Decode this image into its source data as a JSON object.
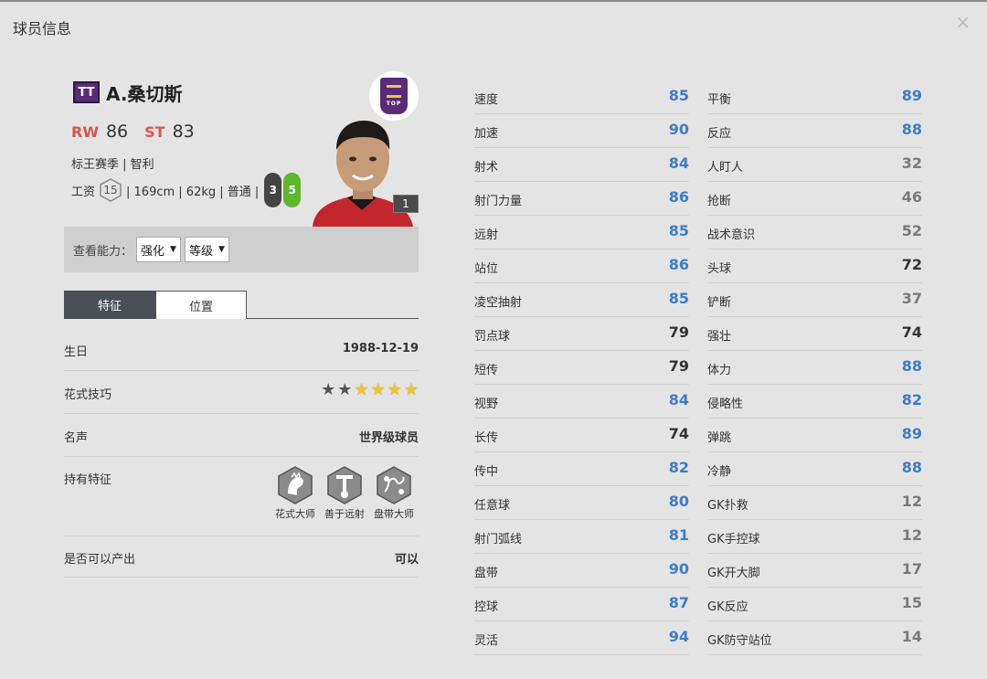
{
  "dialog": {
    "title": "球员信息",
    "close": "×"
  },
  "player": {
    "card_type": "TT",
    "name": "A.桑切斯",
    "positions": [
      {
        "pos": "RW",
        "rating": "86"
      },
      {
        "pos": "ST",
        "rating": "83"
      }
    ],
    "season_line": "标王赛季 | 智利",
    "salary_label": "工资",
    "salary": "15",
    "body_line": "| 169cm | 62kg | 普通 |",
    "weak_foot": "3",
    "strong_foot": "5",
    "club_badge_text": "TOP",
    "level": "1"
  },
  "ability": {
    "label": "查看能力：",
    "select1": "强化",
    "select2": "等级"
  },
  "tabs": [
    "特征",
    "位置"
  ],
  "details": {
    "birthday_label": "生日",
    "birthday": "1988-12-19",
    "skill_label": "花式技巧",
    "skill_stars": 5,
    "skill_dark_stars": 2,
    "reputation_label": "名声",
    "reputation": "世界级球员",
    "traits_label": "持有特征",
    "traits": [
      "花式大师",
      "善于远射",
      "盘带大师"
    ],
    "producible_label": "是否可以产出",
    "producible": "可以"
  },
  "stats_left": [
    {
      "name": "速度",
      "value": "85",
      "tone": "blue"
    },
    {
      "name": "加速",
      "value": "90",
      "tone": "blue"
    },
    {
      "name": "射术",
      "value": "84",
      "tone": "blue"
    },
    {
      "name": "射门力量",
      "value": "86",
      "tone": "blue"
    },
    {
      "name": "远射",
      "value": "85",
      "tone": "blue"
    },
    {
      "name": "站位",
      "value": "86",
      "tone": "blue"
    },
    {
      "name": "凌空抽射",
      "value": "85",
      "tone": "blue"
    },
    {
      "name": "罚点球",
      "value": "79",
      "tone": "black"
    },
    {
      "name": "短传",
      "value": "79",
      "tone": "black"
    },
    {
      "name": "视野",
      "value": "84",
      "tone": "blue"
    },
    {
      "name": "长传",
      "value": "74",
      "tone": "black"
    },
    {
      "name": "传中",
      "value": "82",
      "tone": "blue"
    },
    {
      "name": "任意球",
      "value": "80",
      "tone": "blue"
    },
    {
      "name": "射门弧线",
      "value": "81",
      "tone": "blue"
    },
    {
      "name": "盘带",
      "value": "90",
      "tone": "blue"
    },
    {
      "name": "控球",
      "value": "87",
      "tone": "blue"
    },
    {
      "name": "灵活",
      "value": "94",
      "tone": "blue"
    }
  ],
  "stats_right": [
    {
      "name": "平衡",
      "value": "89",
      "tone": "blue"
    },
    {
      "name": "反应",
      "value": "88",
      "tone": "blue"
    },
    {
      "name": "人盯人",
      "value": "32",
      "tone": "gray"
    },
    {
      "name": "抢断",
      "value": "46",
      "tone": "gray"
    },
    {
      "name": "战术意识",
      "value": "52",
      "tone": "gray"
    },
    {
      "name": "头球",
      "value": "72",
      "tone": "black"
    },
    {
      "name": "铲断",
      "value": "37",
      "tone": "gray"
    },
    {
      "name": "强壮",
      "value": "74",
      "tone": "black"
    },
    {
      "name": "体力",
      "value": "88",
      "tone": "blue"
    },
    {
      "name": "侵略性",
      "value": "82",
      "tone": "blue"
    },
    {
      "name": "弹跳",
      "value": "89",
      "tone": "blue"
    },
    {
      "name": "冷静",
      "value": "88",
      "tone": "blue"
    },
    {
      "name": "GK扑救",
      "value": "12",
      "tone": "gray"
    },
    {
      "name": "GK手控球",
      "value": "12",
      "tone": "gray"
    },
    {
      "name": "GK开大脚",
      "value": "17",
      "tone": "gray"
    },
    {
      "name": "GK反应",
      "value": "15",
      "tone": "gray"
    },
    {
      "name": "GK防守站位",
      "value": "14",
      "tone": "gray"
    }
  ],
  "colors": {
    "stat_blue": "#3d7cc9",
    "position_red": "#d9534f",
    "card_purple": "#5a2b78",
    "strong_foot_green": "#5cb82c"
  },
  "icons": [
    "close-icon",
    "club-badge-icon",
    "player-portrait",
    "star-icon",
    "flair-icon",
    "long-shot-icon",
    "dribbler-icon"
  ]
}
